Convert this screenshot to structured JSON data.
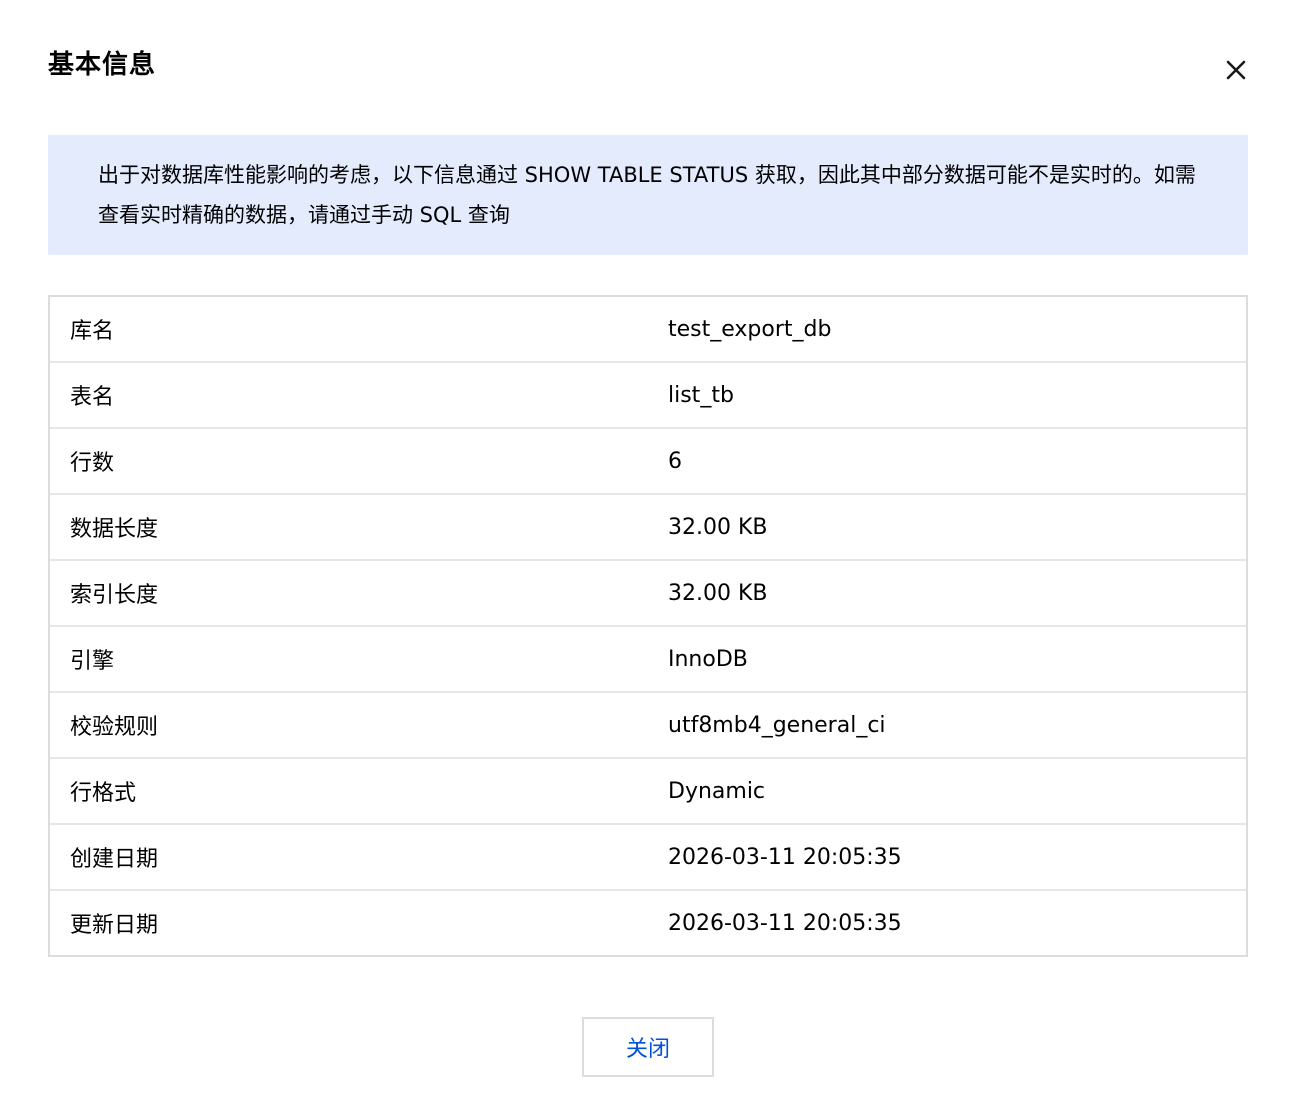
{
  "dialog": {
    "title": "基本信息",
    "close_icon": "close-icon",
    "notice": "出于对数据库性能影响的考虑，以下信息通过 SHOW TABLE STATUS 获取，因此其中部分数据可能不是实时的。如需查看实时精确的数据，请通过手动 SQL 查询",
    "rows": [
      {
        "key": "库名",
        "value": "test_export_db"
      },
      {
        "key": "表名",
        "value": "list_tb"
      },
      {
        "key": "行数",
        "value": "6"
      },
      {
        "key": "数据长度",
        "value": "32.00 KB"
      },
      {
        "key": "索引长度",
        "value": "32.00 KB"
      },
      {
        "key": "引擎",
        "value": "InnoDB"
      },
      {
        "key": "校验规则",
        "value": "utf8mb4_general_ci"
      },
      {
        "key": "行格式",
        "value": "Dynamic"
      },
      {
        "key": "创建日期",
        "value": "2026-03-11 20:05:35"
      },
      {
        "key": "更新日期",
        "value": "2026-03-11 20:05:35"
      }
    ],
    "close_button_label": "关闭"
  },
  "colors": {
    "notice_bg": "#e3ebfd",
    "border": "#dcdcdc",
    "primary": "#0052d9",
    "text": "#000000"
  }
}
